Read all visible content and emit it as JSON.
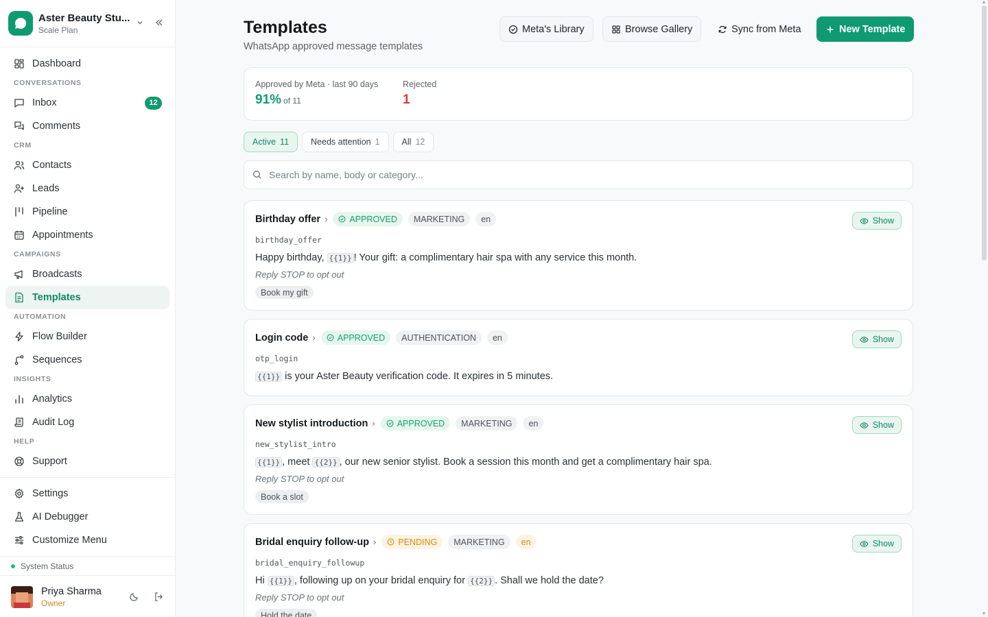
{
  "workspace": {
    "name": "Aster Beauty Stu...",
    "plan": "Scale Plan"
  },
  "sidebar": {
    "dashboard": "Dashboard",
    "sections": {
      "conversations": "CONVERSATIONS",
      "crm": "CRM",
      "campaigns": "CAMPAIGNS",
      "automation": "AUTOMATION",
      "insights": "INSIGHTS",
      "help": "HELP"
    },
    "inbox": "Inbox",
    "inbox_badge": "12",
    "comments": "Comments",
    "contacts": "Contacts",
    "leads": "Leads",
    "pipeline": "Pipeline",
    "appointments": "Appointments",
    "broadcasts": "Broadcasts",
    "templates": "Templates",
    "flow_builder": "Flow Builder",
    "sequences": "Sequences",
    "analytics": "Analytics",
    "audit_log": "Audit Log",
    "support": "Support",
    "settings": "Settings",
    "ai_debugger": "AI Debugger",
    "customize_menu": "Customize Menu"
  },
  "system_status": "System Status",
  "user": {
    "name": "Priya Sharma",
    "role": "Owner"
  },
  "header": {
    "title": "Templates",
    "subtitle": "WhatsApp approved message templates",
    "metas_library": "Meta's Library",
    "browse_gallery": "Browse Gallery",
    "sync_from_meta": "Sync from Meta",
    "new_template": "New Template"
  },
  "stats": {
    "approved_label": "Approved by Meta · last 90 days",
    "approved_value": "91%",
    "approved_of": "of 11",
    "rejected_label": "Rejected",
    "rejected_value": "1"
  },
  "filters": {
    "active": {
      "label": "Active",
      "count": "11"
    },
    "needs_attention": {
      "label": "Needs attention",
      "count": "1"
    },
    "all": {
      "label": "All",
      "count": "12"
    }
  },
  "search": {
    "placeholder": "Search by name, body or category..."
  },
  "templates": [
    {
      "title": "Birthday offer",
      "status": "APPROVED",
      "category": "MARKETING",
      "lang": "en",
      "code": "birthday_offer",
      "body_1": "Happy birthday, ",
      "var_1": "{{1}}",
      "body_2": "! Your gift: a complimentary hair spa with any service this month.",
      "footer": "Reply STOP to opt out",
      "button": "Book my gift",
      "show": "Show"
    },
    {
      "title": "Login code",
      "status": "APPROVED",
      "category": "AUTHENTICATION",
      "lang": "en",
      "code": "otp_login",
      "var_1": "{{1}}",
      "body_1": " is your Aster Beauty verification code. It expires in 5 minutes.",
      "show": "Show"
    },
    {
      "title": "New stylist introduction",
      "status": "APPROVED",
      "category": "MARKETING",
      "lang": "en",
      "code": "new_stylist_intro",
      "var_1": "{{1}}",
      "body_1": ", meet ",
      "var_2": "{{2}}",
      "body_2": ", our new senior stylist. Book a session this month and get a complimentary hair spa.",
      "footer": "Reply STOP to opt out",
      "button": "Book a slot",
      "show": "Show"
    },
    {
      "title": "Bridal enquiry follow-up",
      "status": "PENDING",
      "category": "MARKETING",
      "lang": "en",
      "code": "bridal_enquiry_followup",
      "body_1": "Hi ",
      "var_1": "{{1}}",
      "body_2": ", following up on your bridal enquiry for ",
      "var_2": "{{2}}",
      "body_3": ". Shall we hold the date?",
      "footer": "Reply STOP to opt out",
      "button": "Hold the date",
      "show": "Show"
    }
  ],
  "colors": {
    "accent": "#0f9a72",
    "danger": "#d93a3a",
    "pending": "#d98a10"
  }
}
